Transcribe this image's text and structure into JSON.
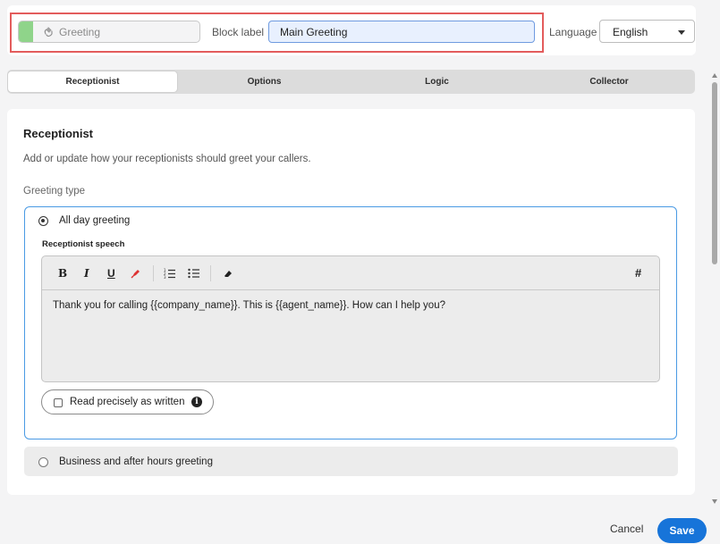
{
  "header": {
    "block_type": "Greeting",
    "block_label_caption": "Block label",
    "block_label_value": "Main Greeting",
    "language_caption": "Language",
    "language_value": "English"
  },
  "tabs": [
    {
      "label": "Receptionist",
      "active": true
    },
    {
      "label": "Options",
      "active": false
    },
    {
      "label": "Logic",
      "active": false
    },
    {
      "label": "Collector",
      "active": false
    }
  ],
  "section": {
    "title": "Receptionist",
    "description": "Add or update how your receptionists should greet your callers.",
    "greeting_type_label": "Greeting type"
  },
  "greeting_options": [
    {
      "label": "All day greeting",
      "selected": true
    },
    {
      "label": "Business and after hours greeting",
      "selected": false
    }
  ],
  "editor": {
    "label": "Receptionist speech",
    "toolbar": {
      "bold": "B",
      "italic": "I",
      "underline": "U",
      "hash": "#"
    },
    "content": "Thank you for calling {{company_name}}. This is {{agent_name}}. How can I help you?"
  },
  "read_precisely": {
    "label": "Read precisely as written",
    "checked": false
  },
  "footer": {
    "cancel_label": "Cancel",
    "save_label": "Save"
  },
  "colors": {
    "accent": "#1774d9",
    "highlight_border": "#e35c5c",
    "block_stripe": "#8fd48a",
    "focus_border": "#4a9ae4"
  }
}
